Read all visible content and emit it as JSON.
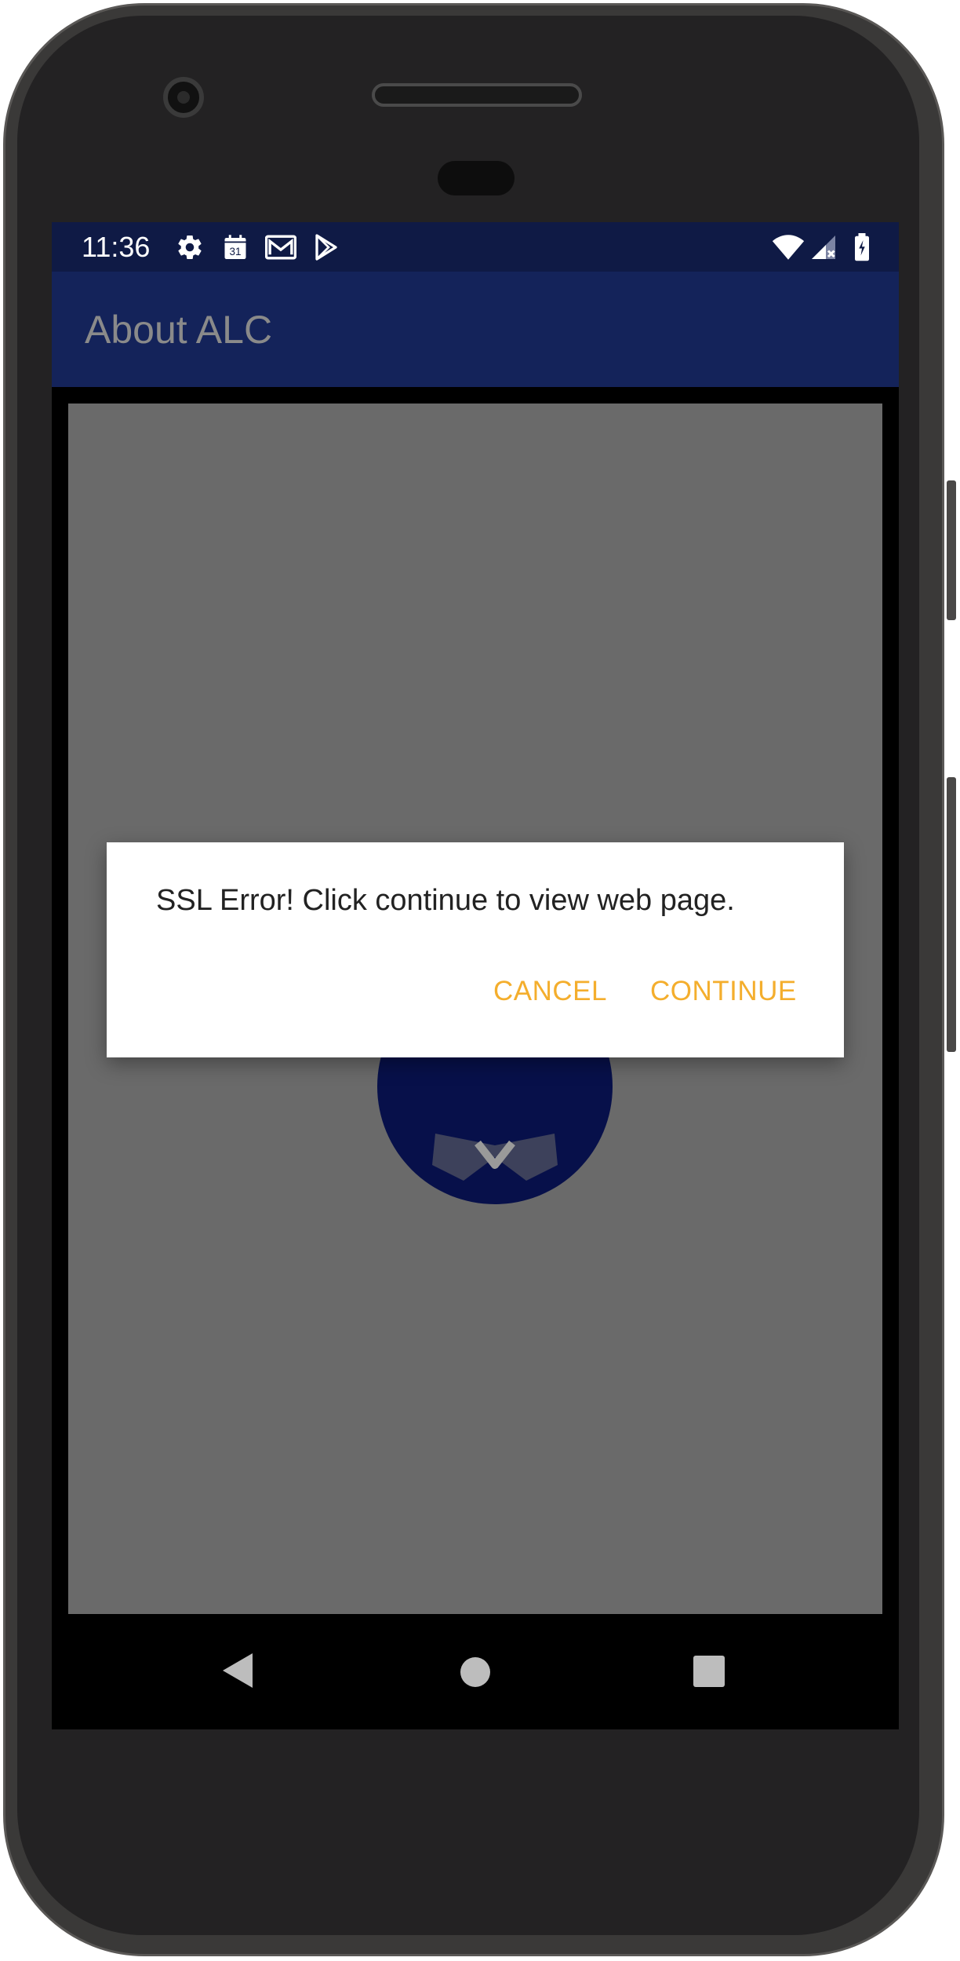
{
  "status_bar": {
    "time": "11:36",
    "left_icons": [
      "gear-icon",
      "calendar-icon",
      "gmail-icon",
      "play-store-icon"
    ],
    "calendar_date": "31",
    "right_icons": [
      "wifi-icon",
      "signal-icon",
      "battery-icon"
    ]
  },
  "app_bar": {
    "title": "About ALC"
  },
  "dialog": {
    "message": "SSL Error! Click continue to view web page.",
    "cancel_label": "CANCEL",
    "continue_label": "CONTINUE"
  },
  "nav_bar": {
    "icons": [
      "back-icon",
      "home-icon",
      "recents-icon"
    ]
  },
  "colors": {
    "status_bar": "#0f1a45",
    "app_bar": "#14235a",
    "app_title": "#8a8a8a",
    "web_background": "#6a6a6a",
    "logo": "#07104a",
    "dialog_accent": "#f4ae2d"
  }
}
